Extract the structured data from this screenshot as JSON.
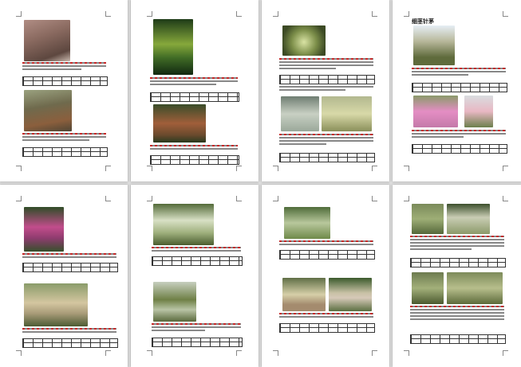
{
  "page6": {
    "heading": "细茎针茅"
  }
}
